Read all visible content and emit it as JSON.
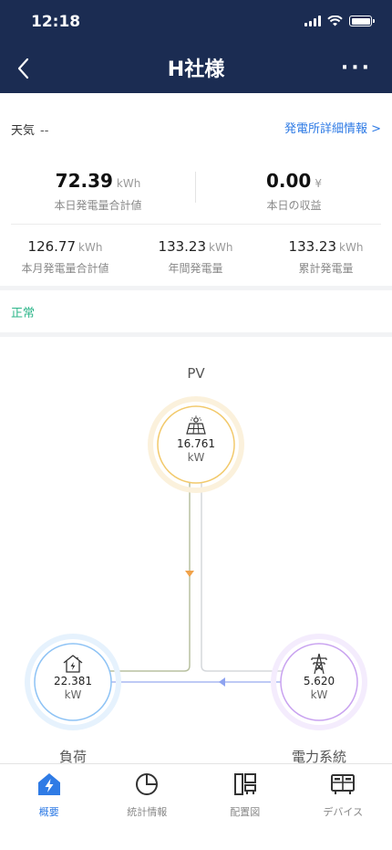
{
  "status_bar": {
    "time": "12:18"
  },
  "header": {
    "title": "H社様",
    "more": "···"
  },
  "overview": {
    "weather_label": "天気",
    "weather_value": "--",
    "detail_link": "発電所詳細情報 >",
    "today_generation": {
      "value": "72.39",
      "unit": "kWh",
      "label": "本日発電量合計値"
    },
    "today_revenue": {
      "value": "0.00",
      "unit": "¥",
      "label": "本日の収益"
    },
    "month_generation": {
      "value": "126.77",
      "unit": "kWh",
      "label": "本月発電量合計値"
    },
    "year_generation": {
      "value": "133.23",
      "unit": "kWh",
      "label": "年間発電量"
    },
    "total_generation": {
      "value": "133.23",
      "unit": "kWh",
      "label": "累計発電量"
    }
  },
  "status": {
    "text": "正常"
  },
  "flow": {
    "pv": {
      "label": "PV",
      "value": "16.761",
      "unit": "kW"
    },
    "load": {
      "label": "負荷",
      "value": "22.381",
      "unit": "kW"
    },
    "grid": {
      "label": "電力系統",
      "value": "5.620",
      "unit": "kW"
    }
  },
  "tabs": [
    {
      "label": "概要",
      "icon": "home-bolt-icon",
      "active": true
    },
    {
      "label": "統計情報",
      "icon": "pie-chart-icon",
      "active": false
    },
    {
      "label": "配置図",
      "icon": "layout-icon",
      "active": false
    },
    {
      "label": "デバイス",
      "icon": "device-icon",
      "active": false
    }
  ],
  "colors": {
    "header_bg": "#1b2c52",
    "accent": "#2f7be5",
    "status_ok": "#2db68a",
    "pv_ring": "#f2c96b",
    "load_ring": "#8ec3f5",
    "grid_ring": "#c9a3f0"
  }
}
